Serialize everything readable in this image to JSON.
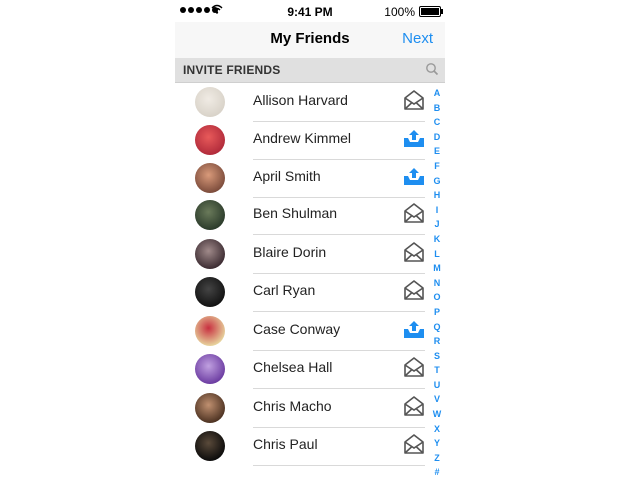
{
  "status_bar": {
    "time": "9:41 PM",
    "battery": "100%"
  },
  "nav": {
    "title": "My Friends",
    "next": "Next"
  },
  "section": {
    "label": "INVITE FRIENDS"
  },
  "friends": [
    {
      "name": "Allison Harvard",
      "action": "mail-icon",
      "avatar_colors": [
        "#d8d2c8",
        "#f0ebe4"
      ]
    },
    {
      "name": "Andrew Kimmel",
      "action": "upload-icon",
      "avatar_colors": [
        "#b02a3a",
        "#e85a5a"
      ]
    },
    {
      "name": "April Smith",
      "action": "upload-icon",
      "avatar_colors": [
        "#7a4a3a",
        "#d99a7a"
      ]
    },
    {
      "name": "Ben Shulman",
      "action": "mail-icon",
      "avatar_colors": [
        "#2a3a2a",
        "#6a7a5a"
      ]
    },
    {
      "name": "Blaire Dorin",
      "action": "mail-icon",
      "avatar_colors": [
        "#3a2a30",
        "#a08a8a"
      ]
    },
    {
      "name": "Carl Ryan",
      "action": "mail-icon",
      "avatar_colors": [
        "#111111",
        "#444444"
      ]
    },
    {
      "name": "Case Conway",
      "action": "upload-icon",
      "avatar_colors": [
        "#e8d8a0",
        "#c83040"
      ]
    },
    {
      "name": "Chelsea Hall",
      "action": "mail-icon",
      "avatar_colors": [
        "#6a3aa0",
        "#c0a0e0"
      ]
    },
    {
      "name": "Chris Macho",
      "action": "mail-icon",
      "avatar_colors": [
        "#4a3020",
        "#c09070"
      ]
    },
    {
      "name": "Chris Paul",
      "action": "mail-icon",
      "avatar_colors": [
        "#0a0a0a",
        "#5a4a3a"
      ]
    }
  ],
  "index_letters": [
    "A",
    "B",
    "C",
    "D",
    "E",
    "F",
    "G",
    "H",
    "I",
    "J",
    "K",
    "L",
    "M",
    "N",
    "O",
    "P",
    "Q",
    "R",
    "S",
    "T",
    "U",
    "V",
    "W",
    "X",
    "Y",
    "Z",
    "#"
  ],
  "colors": {
    "accent": "#1e8ef0",
    "mail": "#555555"
  }
}
